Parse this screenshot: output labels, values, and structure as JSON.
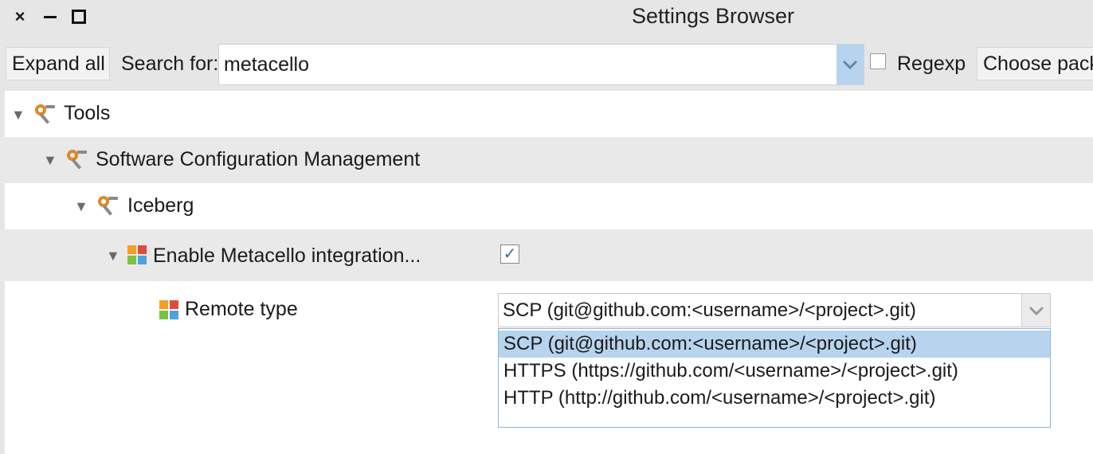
{
  "window": {
    "title": "Settings Browser",
    "controls": {
      "close_glyph": "×"
    }
  },
  "toolbar": {
    "expand_all_label": "Expand all",
    "search_label": "Search for:",
    "search_value": "metacello",
    "regexp_label": "Regexp",
    "regexp_checked": false,
    "choose_packages_label": "Choose packages"
  },
  "tree": {
    "tools": {
      "label": "Tools",
      "expanded": true
    },
    "scm": {
      "label": "Software Configuration Management",
      "expanded": true
    },
    "iceberg": {
      "label": "Iceberg",
      "expanded": true
    },
    "metacello": {
      "label": "Enable Metacello integration...",
      "expanded": true,
      "checked": true
    },
    "remote_type": {
      "label": "Remote type",
      "selected_value": "SCP (git@github.com:<username>/<project>.git)",
      "options": [
        "SCP (git@github.com:<username>/<project>.git)",
        "HTTPS (https://github.com/<username>/<project>.git)",
        "HTTP (http://github.com/<username>/<project>.git)"
      ],
      "highlighted_option": 0
    }
  },
  "icons": {
    "expand_arrow": "▼",
    "tools_icon": "wrench-gear-icon",
    "setting_icon": "four-color-grid-icon",
    "dropdown_icon": "chevron-down-icon",
    "checkmark": "✓"
  },
  "colors": {
    "selection": "#b7d4ee",
    "toolbar_bg": "#e6e6e6",
    "row_alt_bg": "#e9e9e9",
    "icon_orange": "#d98a2b",
    "icon_grey": "#8a8a8a",
    "grid_orange": "#f5a01e",
    "grid_red": "#e04b3a",
    "grid_green": "#7cc241",
    "grid_blue": "#4aa3df"
  }
}
